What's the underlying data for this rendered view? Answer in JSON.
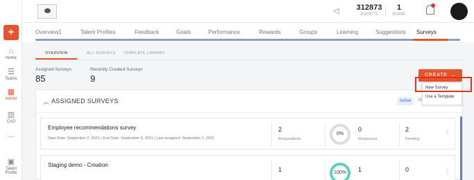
{
  "sidebar": {
    "add_icon": "plus-icon",
    "items": [
      {
        "label": "Home",
        "icon": "home-icon",
        "glyph": "⌂"
      },
      {
        "label": "Teams",
        "icon": "team-icon",
        "glyph": "☰"
      },
      {
        "label": "Admin",
        "icon": "admin-icon",
        "glyph": "▦",
        "active": true
      },
      {
        "label": "CxO",
        "icon": "chart-icon",
        "glyph": "▥"
      },
      {
        "label": "...",
        "icon": "more-icon",
        "glyph": ""
      },
      {
        "label": "Talent Profile",
        "icon": "profile-icon",
        "glyph": "▣"
      }
    ]
  },
  "topbar": {
    "points_value": "312873",
    "points_label": "POINTS",
    "rank_value": "1",
    "rank_label": "RANK"
  },
  "nav": {
    "tabs": [
      "Overview1",
      "Talent Profiles",
      "Feedback",
      "Goals",
      "Performance",
      "Rewards",
      "Groups",
      "Learning",
      "Suggestions",
      "Surveys"
    ],
    "active": "Surveys"
  },
  "subtabs": [
    "OVERVIEW",
    "ALL SURVEYS",
    "TEMPLATE LIBRARY"
  ],
  "summary": {
    "assigned_label": "Assigned Surveys",
    "assigned_value": "85",
    "recent_label": "Recently Created Surveys",
    "recent_value": "9"
  },
  "create": {
    "label": "CREATE",
    "options": [
      "New Survey",
      "Use a Template"
    ]
  },
  "assigned": {
    "title": "ASSIGNED SURVEYS",
    "active_pill": "Active",
    "status_label": "Status",
    "rows": [
      {
        "name": "Employee recommendations survey",
        "meta": "Start Date: September 2, 2021   |   End Date: September 4, 2021   |   Last assigned: September 2, 2021",
        "respondents": "2",
        "respondents_label": "Respondents",
        "percent": "0%",
        "responses": "0",
        "responses_label": "Responses",
        "pending": "2",
        "pending_label": "Pending"
      },
      {
        "name": "Staging demo - Creation",
        "meta": "",
        "respondents": "1",
        "respondents_label": "Respondents",
        "percent": "100%",
        "responses": "1",
        "responses_label": "Responses",
        "pending": "0",
        "pending_label": "Pending"
      }
    ]
  },
  "colors": {
    "accent": "#e8532b",
    "nav_track": "#8b9ec8",
    "ring_complete": "#5ed0c0"
  }
}
